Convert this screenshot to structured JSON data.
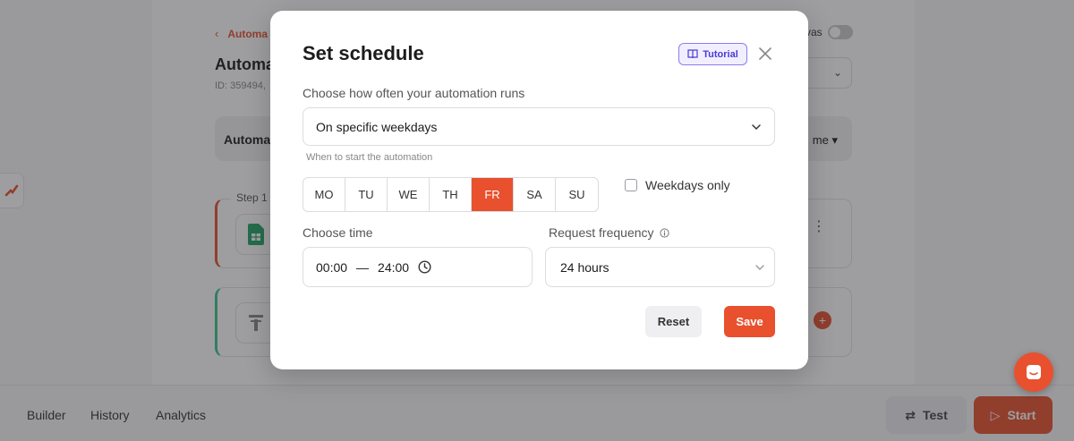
{
  "background": {
    "breadcrumb": "Automa",
    "title": "Automa",
    "id_text": "ID: 359494,",
    "toolbar_label": "Automa",
    "toolbar_right": "me",
    "canvas_toggle_label": "vas",
    "step1_label": "Step 1",
    "bottom_tabs": [
      "Builder",
      "History",
      "Analytics"
    ],
    "test_label": "Test",
    "start_label": "Start"
  },
  "modal": {
    "title": "Set schedule",
    "tutorial_label": "Tutorial",
    "frequency_label": "Choose how often your automation runs",
    "frequency_value": "On specific weekdays",
    "hint": "When to start the automation",
    "days": [
      "MO",
      "TU",
      "WE",
      "TH",
      "FR",
      "SA",
      "SU"
    ],
    "active_day": "FR",
    "weekdays_only_label": "Weekdays only",
    "weekdays_only_checked": false,
    "time_label": "Choose time",
    "time_from": "00:00",
    "time_separator": "—",
    "time_to": "24:00",
    "request_frequency_label": "Request frequency",
    "request_frequency_value": "24 hours",
    "reset_label": "Reset",
    "save_label": "Save"
  },
  "colors": {
    "accent": "#e8502e",
    "tutorial": "#4b3bd6",
    "step2_accent": "#3cc48f"
  }
}
